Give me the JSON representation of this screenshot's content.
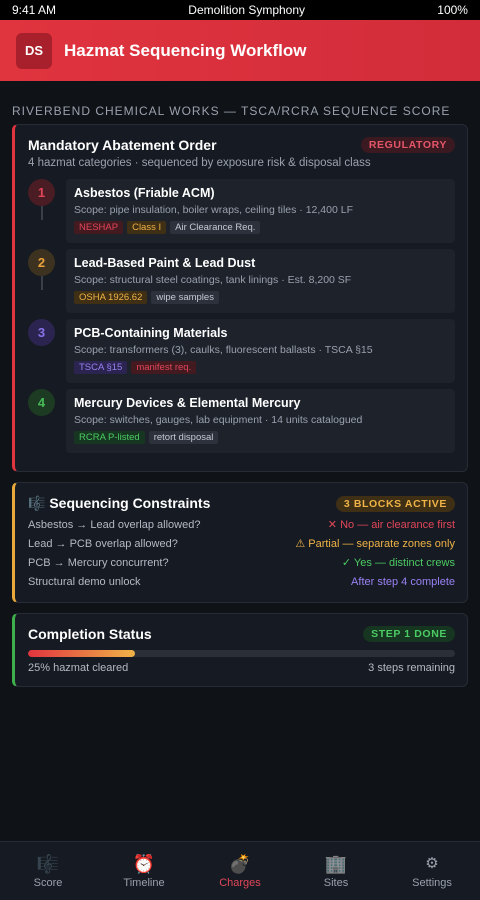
{
  "status_bar": {
    "time": "9:41 AM",
    "title": "Demolition Symphony",
    "battery": "100%"
  },
  "header": {
    "avatar": "DS",
    "title": "Hazmat Sequencing Workflow"
  },
  "section_label": "RIVERBEND CHEMICAL WORKS — TSCA/RCRA SEQUENCE SCORE",
  "order_card": {
    "title": "Mandatory Abatement Order",
    "badge": "REGULATORY",
    "subtitle": "4 hazmat categories · sequenced by exposure risk & disposal class",
    "steps": [
      {
        "num": "1",
        "title": "Asbestos (Friable ACM)",
        "scope": "Scope: pipe insulation, boiler wraps, ceiling tiles · 12,400 LF",
        "tags": [
          "NESHAP",
          "Class I",
          "Air Clearance Req."
        ]
      },
      {
        "num": "2",
        "title": "Lead-Based Paint & Lead Dust",
        "scope": "Scope: structural steel coatings, tank linings · Est. 8,200 SF",
        "tags": [
          "OSHA 1926.62",
          "wipe samples"
        ]
      },
      {
        "num": "3",
        "title": "PCB-Containing Materials",
        "scope": "Scope: transformers (3), caulks, fluorescent ballasts · TSCA §15",
        "tags": [
          "TSCA §15",
          "manifest req."
        ]
      },
      {
        "num": "4",
        "title": "Mercury Devices & Elemental Mercury",
        "scope": "Scope: switches, gauges, lab equipment · 14 units catalogued",
        "tags": [
          "RCRA P-listed",
          "retort disposal"
        ]
      }
    ]
  },
  "constraints_card": {
    "icon": "🎼",
    "title": "Sequencing Constraints",
    "badge": "3 BLOCKS ACTIVE",
    "rows": [
      {
        "q": "Asbestos → Lead overlap allowed?",
        "a": "✕ No — air clearance first"
      },
      {
        "q": "Lead → PCB overlap allowed?",
        "a": "⚠ Partial — separate zones only"
      },
      {
        "q": "PCB → Mercury concurrent?",
        "a": "✓ Yes — distinct crews"
      },
      {
        "q": "Structural demo unlock",
        "a": "After step 4 complete"
      }
    ]
  },
  "completion_card": {
    "title": "Completion Status",
    "badge": "STEP 1 DONE",
    "progress": 0.25,
    "left_label": "25% hazmat cleared",
    "right_label": "3 steps remaining"
  },
  "nav": [
    {
      "icon": "🎼",
      "label": "Score"
    },
    {
      "icon": "⏰",
      "label": "Timeline"
    },
    {
      "icon": "💣",
      "label": "Charges"
    },
    {
      "icon": "🏢",
      "label": "Sites"
    },
    {
      "icon": "⚙",
      "label": "Settings"
    }
  ],
  "colors": {
    "accent": "#e0343f",
    "amber": "#efb347",
    "green": "#4ccb63",
    "purple": "#9a82f5"
  }
}
